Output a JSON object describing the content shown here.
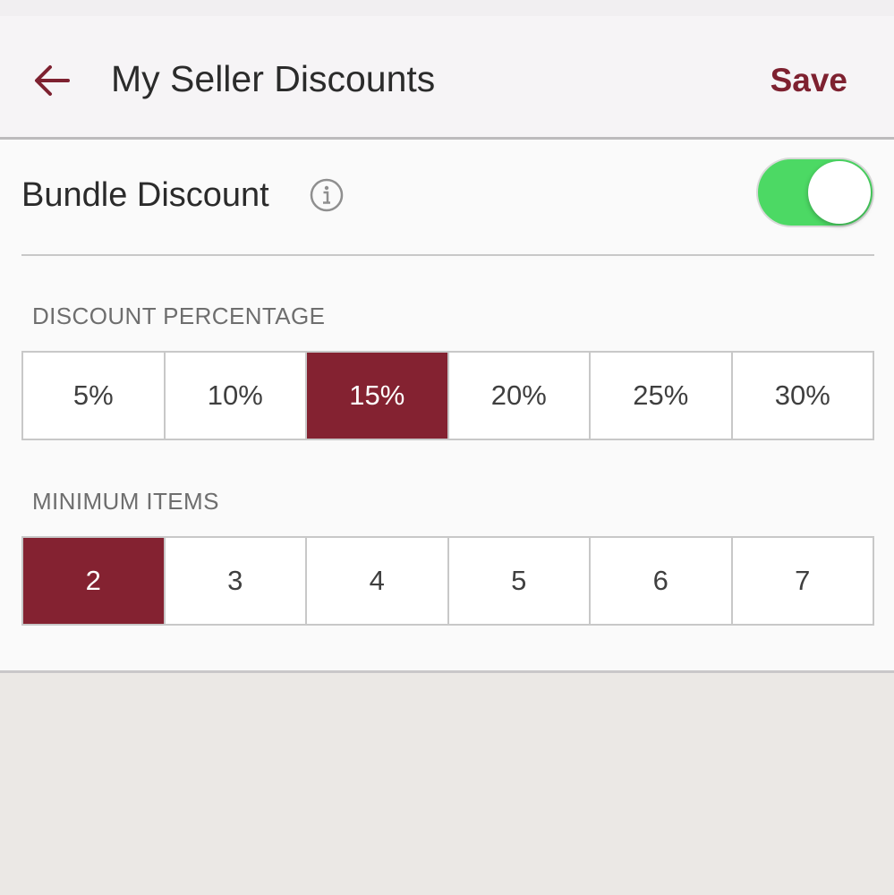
{
  "header": {
    "title": "My Seller Discounts",
    "save_label": "Save",
    "back_icon": "arrow-left-icon"
  },
  "bundle": {
    "label": "Bundle Discount",
    "info_icon": "info-icon",
    "enabled": true
  },
  "discount_percentage": {
    "label": "DISCOUNT PERCENTAGE",
    "options": [
      "5%",
      "10%",
      "15%",
      "20%",
      "25%",
      "30%"
    ],
    "selected": "15%"
  },
  "minimum_items": {
    "label": "MINIMUM ITEMS",
    "options": [
      "2",
      "3",
      "4",
      "5",
      "6",
      "7"
    ],
    "selected": "2"
  },
  "colors": {
    "accent": "#842231",
    "toggle_on": "#4cd964"
  }
}
